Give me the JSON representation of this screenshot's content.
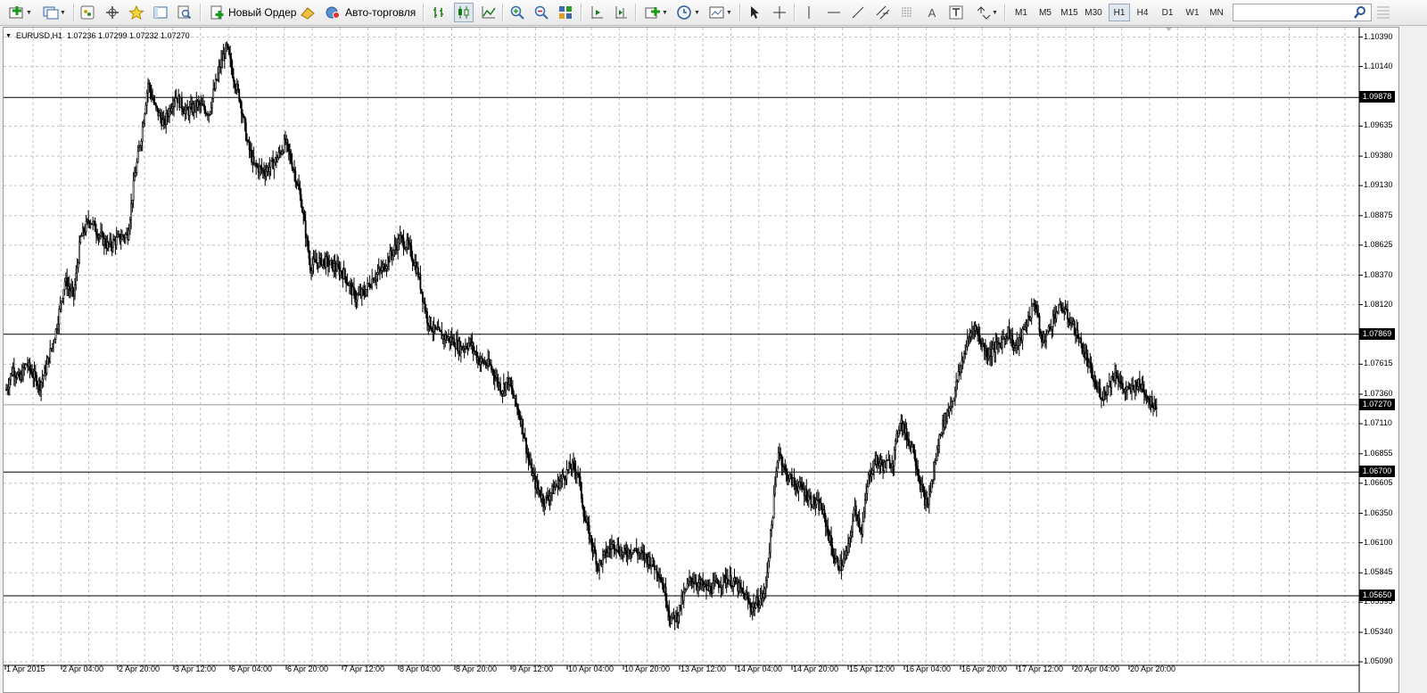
{
  "toolbar": {
    "new_order_label": "Новый Ордер",
    "auto_trading_label": "Авто-торговля",
    "timeframes": [
      "M1",
      "M5",
      "M15",
      "M30",
      "H1",
      "H4",
      "D1",
      "W1",
      "MN"
    ],
    "active_timeframe": "H1",
    "search_value": ""
  },
  "chart": {
    "symbol_timeframe": "EURUSD,H1",
    "ohlc": "1.07236 1.07299 1.07232 1.07270"
  },
  "chart_data": {
    "type": "candlestick",
    "symbol": "EURUSD",
    "timeframe": "H1",
    "y_tick_labels": [
      "1.10390",
      "1.10140",
      "1.09635",
      "1.09380",
      "1.09130",
      "1.08875",
      "1.08625",
      "1.08370",
      "1.08120",
      "1.07615",
      "1.07360",
      "1.07110",
      "1.06855",
      "1.06605",
      "1.06350",
      "1.06100",
      "1.05845",
      "1.05595",
      "1.05340",
      "1.05090"
    ],
    "horizontal_lines": [
      "1.09878",
      "1.07869",
      "1.06700",
      "1.05650"
    ],
    "current_price": "1.07270",
    "ylim": [
      1.0506,
      1.1047
    ],
    "x_tick_labels": [
      "1 Apr 2015",
      "2 Apr 04:00",
      "2 Apr 20:00",
      "3 Apr 12:00",
      "6 Apr 04:00",
      "6 Apr 20:00",
      "7 Apr 12:00",
      "8 Apr 04:00",
      "8 Apr 20:00",
      "9 Apr 12:00",
      "10 Apr 04:00",
      "10 Apr 20:00",
      "13 Apr 12:00",
      "14 Apr 04:00",
      "14 Apr 20:00",
      "15 Apr 12:00",
      "16 Apr 04:00",
      "16 Apr 20:00",
      "17 Apr 12:00",
      "20 Apr 04:00",
      "20 Apr 20:00"
    ],
    "close_path": [
      [
        0,
        1.074
      ],
      [
        6,
        1.0758
      ],
      [
        12,
        1.0748
      ],
      [
        18,
        1.0762
      ],
      [
        24,
        1.0752
      ],
      [
        30,
        1.0744
      ],
      [
        36,
        1.076
      ],
      [
        44,
        1.079
      ],
      [
        52,
        1.0832
      ],
      [
        60,
        1.082
      ],
      [
        66,
        1.0868
      ],
      [
        74,
        1.0885
      ],
      [
        82,
        1.0872
      ],
      [
        90,
        1.0862
      ],
      [
        100,
        1.0868
      ],
      [
        108,
        1.0872
      ],
      [
        114,
        1.092
      ],
      [
        120,
        1.0955
      ],
      [
        126,
        1.1
      ],
      [
        132,
        1.098
      ],
      [
        140,
        1.0965
      ],
      [
        150,
        1.099
      ],
      [
        160,
        1.0975
      ],
      [
        170,
        1.0982
      ],
      [
        180,
        1.0975
      ],
      [
        190,
        1.1015
      ],
      [
        196,
        1.103
      ],
      [
        202,
        1.1005
      ],
      [
        208,
        1.0985
      ],
      [
        214,
        1.095
      ],
      [
        220,
        1.093
      ],
      [
        230,
        1.0925
      ],
      [
        240,
        1.0935
      ],
      [
        248,
        1.095
      ],
      [
        256,
        1.0925
      ],
      [
        262,
        1.09
      ],
      [
        270,
        1.0845
      ],
      [
        280,
        1.085
      ],
      [
        290,
        1.0845
      ],
      [
        300,
        1.0838
      ],
      [
        310,
        1.0818
      ],
      [
        318,
        1.0822
      ],
      [
        326,
        1.0835
      ],
      [
        334,
        1.0842
      ],
      [
        342,
        1.0855
      ],
      [
        350,
        1.0868
      ],
      [
        358,
        1.086
      ],
      [
        366,
        1.0838
      ],
      [
        374,
        1.08
      ],
      [
        380,
        1.079
      ],
      [
        388,
        1.0785
      ],
      [
        396,
        1.0782
      ],
      [
        404,
        1.0775
      ],
      [
        412,
        1.078
      ],
      [
        420,
        1.0765
      ],
      [
        430,
        1.076
      ],
      [
        440,
        1.074
      ],
      [
        446,
        1.0748
      ],
      [
        452,
        1.073
      ],
      [
        458,
        1.0712
      ],
      [
        464,
        1.068
      ],
      [
        470,
        1.066
      ],
      [
        478,
        1.0645
      ],
      [
        486,
        1.0655
      ],
      [
        494,
        1.0665
      ],
      [
        502,
        1.0675
      ],
      [
        508,
        1.067
      ],
      [
        514,
        1.063
      ],
      [
        520,
        1.061
      ],
      [
        526,
        1.059
      ],
      [
        532,
        1.06
      ],
      [
        540,
        1.061
      ],
      [
        548,
        1.06
      ],
      [
        556,
        1.0605
      ],
      [
        564,
        1.06
      ],
      [
        572,
        1.0595
      ],
      [
        580,
        1.0585
      ],
      [
        586,
        1.0565
      ],
      [
        590,
        1.0545
      ],
      [
        596,
        1.0548
      ],
      [
        602,
        1.0565
      ],
      [
        608,
        1.058
      ],
      [
        616,
        1.0575
      ],
      [
        624,
        1.057
      ],
      [
        632,
        1.0575
      ],
      [
        640,
        1.058
      ],
      [
        648,
        1.0575
      ],
      [
        656,
        1.0565
      ],
      [
        662,
        1.0555
      ],
      [
        668,
        1.056
      ],
      [
        674,
        1.0568
      ],
      [
        680,
        1.0625
      ],
      [
        686,
        1.069
      ],
      [
        692,
        1.067
      ],
      [
        700,
        1.066
      ],
      [
        708,
        1.0655
      ],
      [
        716,
        1.0645
      ],
      [
        724,
        1.064
      ],
      [
        730,
        1.062
      ],
      [
        736,
        1.0595
      ],
      [
        742,
        1.059
      ],
      [
        748,
        1.0605
      ],
      [
        754,
        1.064
      ],
      [
        760,
        1.062
      ],
      [
        766,
        1.0665
      ],
      [
        772,
        1.068
      ],
      [
        780,
        1.0675
      ],
      [
        788,
        1.068
      ],
      [
        794,
        1.0715
      ],
      [
        800,
        1.07
      ],
      [
        806,
        1.069
      ],
      [
        812,
        1.066
      ],
      [
        818,
        1.064
      ],
      [
        824,
        1.067
      ],
      [
        830,
        1.0705
      ],
      [
        836,
        1.072
      ],
      [
        842,
        1.0735
      ],
      [
        848,
        1.076
      ],
      [
        854,
        1.078
      ],
      [
        860,
        1.0795
      ],
      [
        866,
        1.078
      ],
      [
        872,
        1.077
      ],
      [
        878,
        1.0775
      ],
      [
        884,
        1.078
      ],
      [
        890,
        1.079
      ],
      [
        896,
        1.0775
      ],
      [
        902,
        1.0785
      ],
      [
        908,
        1.08
      ],
      [
        914,
        1.0815
      ],
      [
        920,
        1.078
      ],
      [
        926,
        1.079
      ],
      [
        932,
        1.0805
      ],
      [
        938,
        1.081
      ],
      [
        944,
        1.08
      ],
      [
        950,
        1.079
      ],
      [
        956,
        1.0775
      ],
      [
        962,
        1.076
      ],
      [
        968,
        1.0742
      ],
      [
        974,
        1.0735
      ],
      [
        980,
        1.0745
      ],
      [
        986,
        1.0755
      ],
      [
        992,
        1.074
      ],
      [
        998,
        1.0738
      ],
      [
        1004,
        1.0745
      ],
      [
        1010,
        1.0742
      ],
      [
        1016,
        1.073
      ],
      [
        1022,
        1.0727
      ]
    ]
  }
}
